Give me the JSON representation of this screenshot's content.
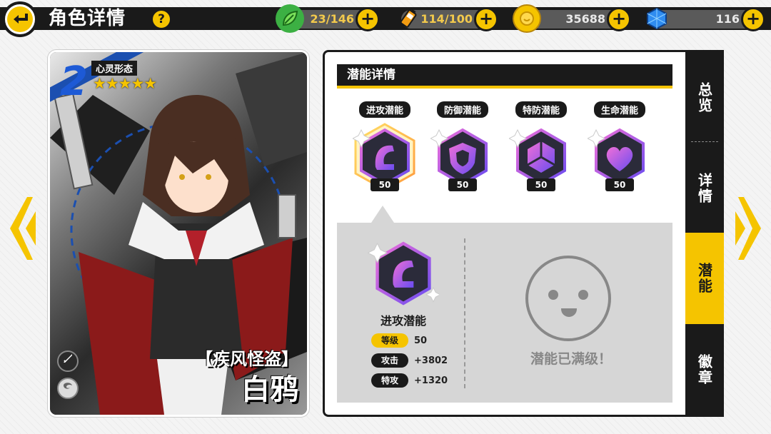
{
  "header": {
    "title": "角色详情",
    "help_label": "?",
    "back_icon": "back-arrow-icon"
  },
  "resources": [
    {
      "name": "stamina",
      "icon": "leaf-icon",
      "value": "23/146",
      "color": "#f2c94c"
    },
    {
      "name": "energy",
      "icon": "battery-icon",
      "value": "114/100",
      "color": "#f2c94c"
    },
    {
      "name": "coins",
      "icon": "coin-icon",
      "value": "35688",
      "color": "#e8e8e8"
    },
    {
      "name": "gems",
      "icon": "gem-icon",
      "value": "116",
      "color": "#e8e8e8"
    }
  ],
  "plus_label": "+",
  "card": {
    "rank": "2",
    "form_label": "心灵形态",
    "stars": "★★★★★",
    "title_sub": "【疾风怪盗】",
    "name": "白鸦"
  },
  "panel": {
    "section_title": "潜能详情",
    "potentials": [
      {
        "label": "进攻潜能",
        "level": "50",
        "icon": "attack-potential-icon",
        "selected": true
      },
      {
        "label": "防御潜能",
        "level": "50",
        "icon": "defense-potential-icon",
        "selected": false
      },
      {
        "label": "特防潜能",
        "level": "50",
        "icon": "special-defense-potential-icon",
        "selected": false
      },
      {
        "label": "生命潜能",
        "level": "50",
        "icon": "life-potential-icon",
        "selected": false
      }
    ],
    "detail": {
      "name": "进攻潜能",
      "stats": [
        {
          "key": "等级",
          "value": "50",
          "highlight": true
        },
        {
          "key": "攻击",
          "value": "+3802",
          "highlight": false
        },
        {
          "key": "特攻",
          "value": "+1320",
          "highlight": false
        }
      ],
      "maxed_text": "潜能已满级！"
    }
  },
  "side_tabs": [
    {
      "label": "总览",
      "active": false
    },
    {
      "label": "详情",
      "active": false
    },
    {
      "label": "潜能",
      "active": true
    },
    {
      "label": "徽章",
      "active": false
    }
  ],
  "colors": {
    "accent": "#f5c400",
    "dark": "#1a1a1a",
    "panel_gray": "#d6d6d6"
  }
}
